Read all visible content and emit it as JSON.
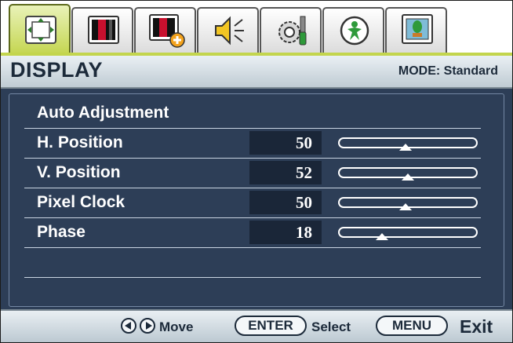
{
  "tabs": [
    {
      "icon": "display-position-icon",
      "active": true
    },
    {
      "icon": "picture-icon",
      "active": false
    },
    {
      "icon": "picture-advanced-icon",
      "active": false
    },
    {
      "icon": "audio-icon",
      "active": false
    },
    {
      "icon": "system-settings-icon",
      "active": false
    },
    {
      "icon": "eco-icon",
      "active": false
    },
    {
      "icon": "save-settings-icon",
      "active": false
    }
  ],
  "header": {
    "title": "DISPLAY",
    "mode": "MODE: Standard"
  },
  "menu": {
    "auto_adjustment": "Auto Adjustment",
    "items": [
      {
        "label": "H. Position",
        "value": "50",
        "level": 50,
        "max": 100
      },
      {
        "label": "V. Position",
        "value": "52",
        "level": 52,
        "max": 100
      },
      {
        "label": "Pixel Clock",
        "value": "50",
        "level": 50,
        "max": 100
      },
      {
        "label": "Phase",
        "value": "18",
        "level": 18,
        "max": 63
      }
    ]
  },
  "footer": {
    "move": "Move",
    "enter": "ENTER",
    "select": "Select",
    "menu": "MENU",
    "exit": "Exit"
  },
  "colors": {
    "accent": "#c3d54d",
    "panel": "#2d3e57",
    "header": "#bfcbd3",
    "text_dark": "#1c2a3a"
  }
}
